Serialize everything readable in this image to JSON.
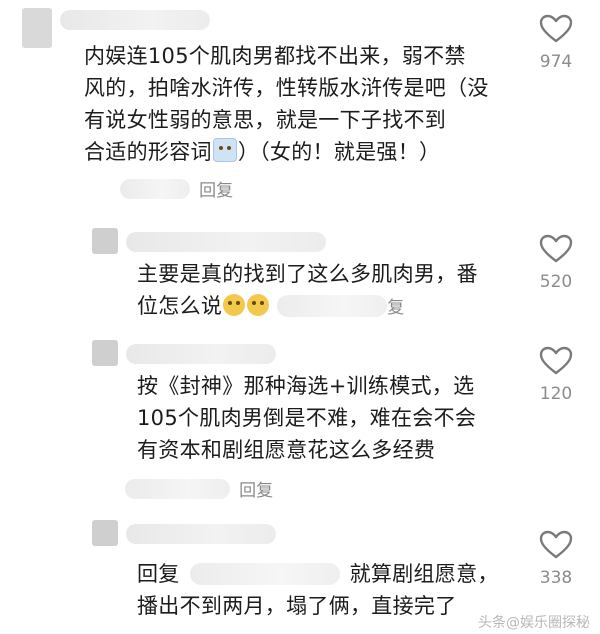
{
  "comments": [
    {
      "lines": [
        "内娱连105个肌肉男都找不出来，弱不禁",
        "风的，拍啥水浒传，性转版水浒传是吧（没",
        "有说女性弱的意思，就是一下子找不到",
        "合适的形容词"
      ],
      "line4_suffix": "）（女的！就是强！）",
      "emoji": "crying-face-emoji",
      "reply_label": "回复",
      "like_count": "974"
    },
    {
      "lines": [
        "主要是真的找到了这么多肌肉男，番",
        "位怎么说"
      ],
      "emoji": "cheeky-face-emoji",
      "reply_label": "复",
      "like_count": "520"
    },
    {
      "lines": [
        "按《封神》那种海选+训练模式，选",
        "105个肌肉男倒是不难，难在会不会",
        "有资本和剧组愿意花这么多经费"
      ],
      "reply_label": "回复",
      "like_count": "120"
    },
    {
      "line1_prefix": "回复",
      "line1_suffix": "就算剧组愿意，",
      "lines": [
        "播出不到两月，塌了俩，直接完了"
      ],
      "like_count": "338"
    }
  ],
  "watermark": "头条@娱乐圈探秘"
}
